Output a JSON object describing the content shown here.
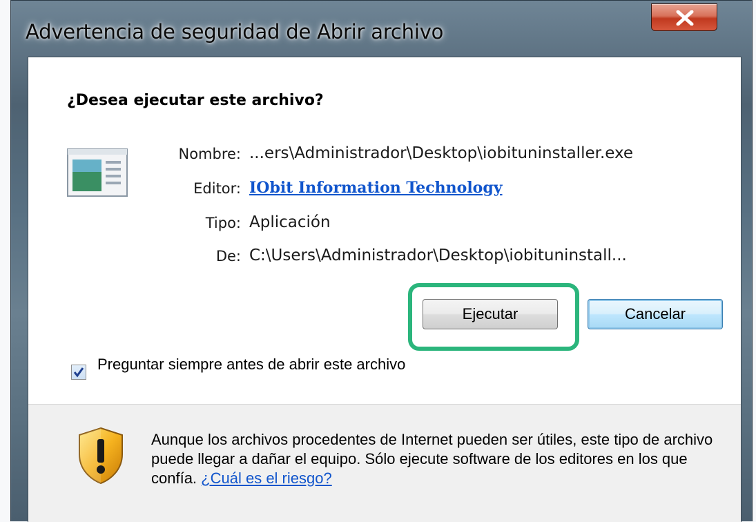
{
  "window": {
    "title": "Advertencia de seguridad de Abrir archivo"
  },
  "dialog": {
    "question": "¿Desea ejecutar este archivo?",
    "fields": {
      "name_label": "Nombre:",
      "name_value": "...ers\\Administrador\\Desktop\\iobituninstaller.exe",
      "editor_label": "Editor:",
      "editor_value": "IObit Information Technology",
      "type_label": "Tipo:",
      "type_value": "Aplicación",
      "from_label": "De:",
      "from_value": "C:\\Users\\Administrador\\Desktop\\iobituninstall..."
    },
    "buttons": {
      "run": "Ejecutar",
      "cancel": "Cancelar"
    },
    "checkbox": {
      "label": "Preguntar siempre antes de abrir este archivo",
      "checked": true
    },
    "warning": {
      "text": "Aunque los archivos procedentes de Internet pueden ser útiles, este tipo de archivo puede llegar a dañar el equipo. Sólo ejecute software de los editores en los que confía.",
      "link": "¿Cuál es el riesgo?"
    }
  },
  "icons": {
    "close": "close-x-icon",
    "file": "application-file-icon",
    "checkbox": "checkmark-icon",
    "warning": "security-shield-warning-icon"
  },
  "colors": {
    "highlight": "#2bb57c",
    "link": "#1155cc",
    "close_button": "#c0391f"
  }
}
